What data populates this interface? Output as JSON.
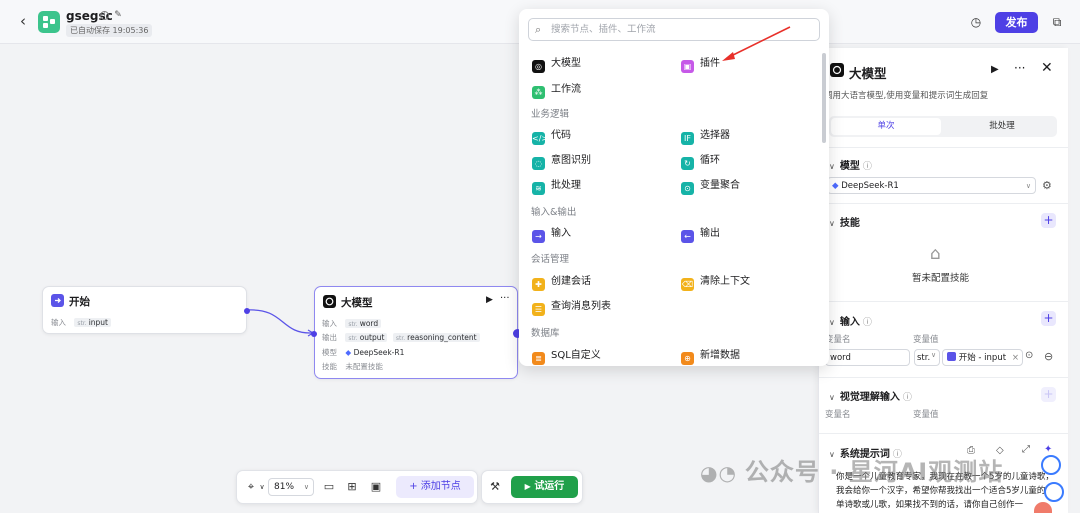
{
  "app": {
    "name": "gsegsc",
    "saved_status": "已自动保存 19:05:36",
    "publish_label": "发布"
  },
  "canvas": {
    "start_node": {
      "title": "开始",
      "row_label": "输入",
      "input_type": "str.",
      "input_name": "input"
    },
    "llm_node": {
      "title": "大模型",
      "input_label": "输入",
      "input_type": "str.",
      "input_name": "word",
      "output_label": "输出",
      "output1_type": "str.",
      "output1_name": "output",
      "output2_type": "str.",
      "output2_name": "reasoning_content",
      "model_label": "模型",
      "model_name": "DeepSeek-R1",
      "skill_label": "技能",
      "skill_value": "未配置技能"
    }
  },
  "picker": {
    "search_placeholder": "搜索节点、插件、工作流",
    "top_items": [
      "大模型",
      "插件",
      "工作流"
    ],
    "sections": [
      {
        "title": "业务逻辑",
        "items": [
          "代码",
          "选择器",
          "意图识别",
          "循环",
          "批处理",
          "变量聚合"
        ]
      },
      {
        "title": "输入&输出",
        "items": [
          "输入",
          "输出"
        ]
      },
      {
        "title": "会话管理",
        "items": [
          "创建会话",
          "清除上下文",
          "查询消息列表"
        ]
      },
      {
        "title": "数据库",
        "items": [
          "SQL自定义",
          "新增数据"
        ]
      }
    ],
    "icon_colors": {
      "llm": "#111111",
      "plugin": "#c659e8",
      "workflow": "#2fbf71",
      "logic": "#16b3a7",
      "io": "#5b54e8",
      "session": "#f2b21b",
      "db": "#f28a1b"
    }
  },
  "panel": {
    "title": "大模型",
    "subtitle": "调用大语言模型,使用变量和提示词生成回复",
    "tab_single": "单次",
    "tab_batch": "批处理",
    "model_section": "模型",
    "model_value": "DeepSeek-R1",
    "skills_section": "技能",
    "skills_empty": "暂未配置技能",
    "input_section": "输入",
    "var_name_label": "变量名",
    "var_value_label": "变量值",
    "input_var_name": "word",
    "input_var_type": "str.",
    "input_var_ref": "开始 - input",
    "vision_section": "视觉理解输入",
    "prompt_section": "系统提示词",
    "prompt_text": "你是一个儿童教育专家，我现在在教一个5岁的儿童诗歌，我会给你一个汉字，希望你帮我找出一个适合5岁儿童的简单诗歌或儿歌，如果找不到的话，请你自己创作一"
  },
  "toolbar": {
    "zoom": "81%",
    "add_node": "添加节点",
    "run": "试运行"
  },
  "watermark": "公众号 · 星河AI观测站",
  "colors": {
    "accent": "#4e40e5",
    "run_green": "#20a04a"
  }
}
